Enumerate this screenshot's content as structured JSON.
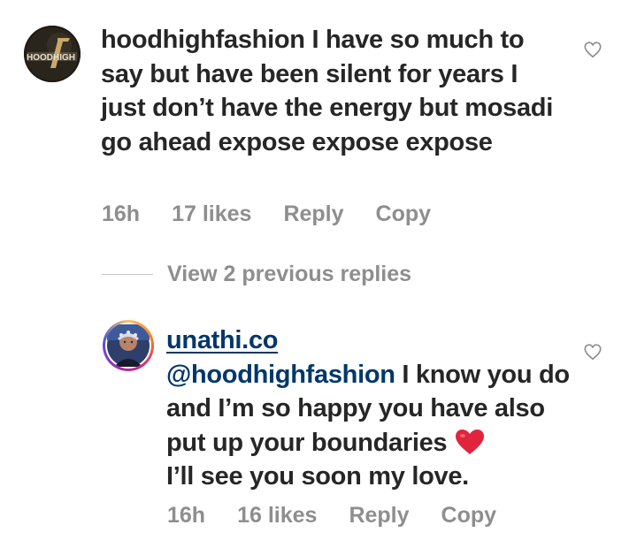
{
  "comments": [
    {
      "username": "hoodhighfashion",
      "text": "I have so much to say but have been silent for years I just don’t have the energy but mosadi go ahead expose expose expose",
      "time": "16h",
      "likes": "17 likes",
      "reply_label": "Reply",
      "copy_label": "Copy",
      "avatar_logo_text": "HOODHIGH"
    },
    {
      "username": "unathi.co",
      "mention": "@hoodhighfashion",
      "text_before_emoji": " I know you do and I’m so happy you have also put up your boundaries ",
      "emoji": "red-heart",
      "text_after_emoji": "I’ll see you soon my love.",
      "time": "16h",
      "likes": "16 likes",
      "reply_label": "Reply",
      "copy_label": "Copy"
    }
  ],
  "view_replies_label": "View 2 previous replies",
  "colors": {
    "primary_text": "#262626",
    "secondary_text": "#8e8e8e",
    "link": "#00376b",
    "heart_emoji": "#e0243c"
  },
  "icons": [
    "like-heart-outline-icon",
    "red-heart-emoji"
  ]
}
